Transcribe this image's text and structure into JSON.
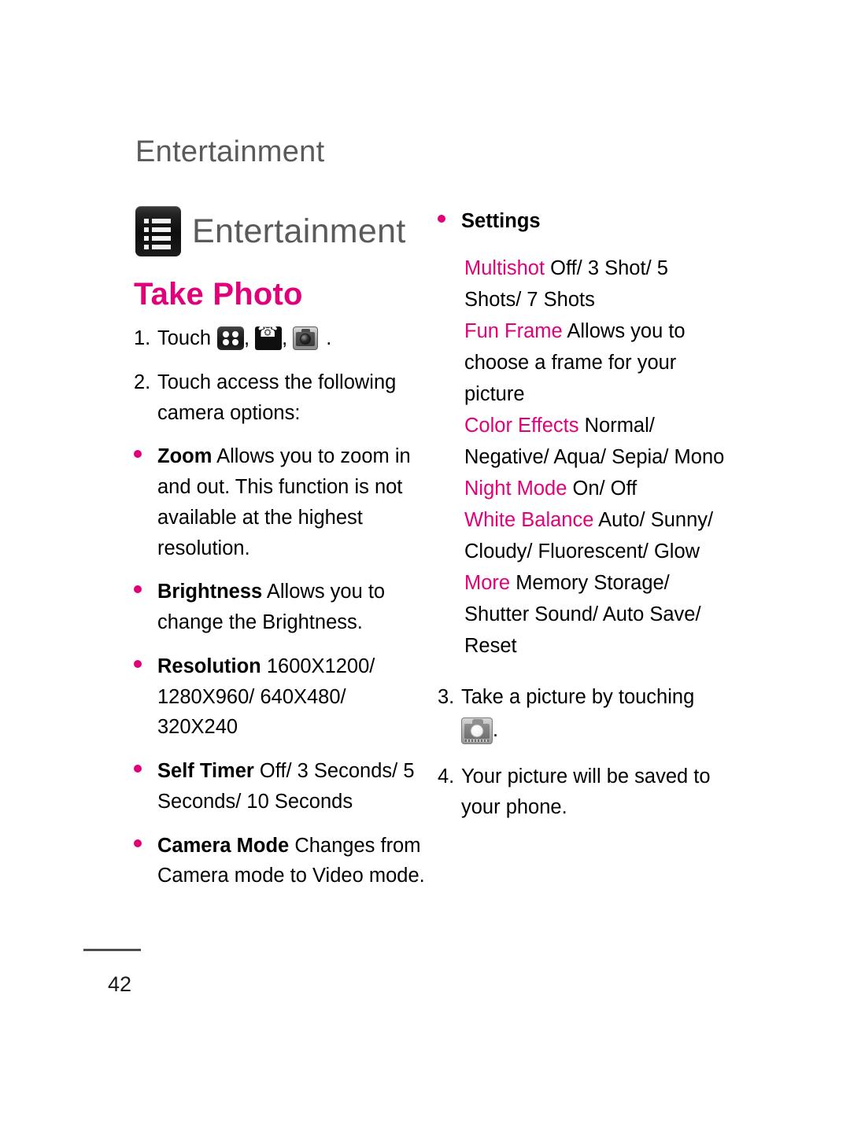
{
  "page": {
    "running_header": "Entertainment",
    "chapter_title": "Entertainment",
    "folio": "42",
    "accent_color": "#e2007a",
    "header_gray": "#5a5a5a"
  },
  "left_column": {
    "section_title": "Take Photo",
    "step1": {
      "num": "1.",
      "label": "Touch",
      "sep1": ",",
      "sep2": ",",
      "period": ".",
      "icons": [
        "grid-icon",
        "phone-icon",
        "camera-icon"
      ]
    },
    "step2": {
      "num": "2.",
      "text": "Touch access the following camera options:"
    },
    "bullets": [
      {
        "lead": "Zoom",
        "body": " Allows you to zoom in and out. This function is not available at the highest resolution."
      },
      {
        "lead": "Brightness",
        "body": " Allows you to change the Brightness."
      },
      {
        "lead": "Resolution",
        "body": " 1600X1200/ 1280X960/ 640X480/ 320X240"
      },
      {
        "lead": "Self Timer",
        "body": " Off/ 3 Seconds/ 5 Seconds/ 10 Seconds"
      },
      {
        "lead": "Camera Mode",
        "body": " Changes from Camera mode to Video mode."
      }
    ]
  },
  "right_column": {
    "settings_bullet": "Settings",
    "settings": [
      {
        "key": "Multishot",
        "value": " Off/ 3 Shot/ 5 Shots/ 7 Shots"
      },
      {
        "key": "Fun Frame",
        "value": " Allows you to choose a frame for your picture"
      },
      {
        "key": "Color Effects",
        "value": " Normal/ Negative/ Aqua/ Sepia/ Mono"
      },
      {
        "key": "Night Mode",
        "value": "  On/ Off"
      },
      {
        "key": "White Balance",
        "value": "  Auto/ Sunny/ Cloudy/ Fluorescent/ Glow"
      },
      {
        "key": "More",
        "value": " Memory Storage/ Shutter Sound/ Auto Save/ Reset"
      }
    ],
    "step3": {
      "num": "3.",
      "text": "Take a picture by touching",
      "period": ".",
      "icon": "camera-icon"
    },
    "step4": {
      "num": "4.",
      "text": "Your picture will be saved to your phone."
    }
  }
}
